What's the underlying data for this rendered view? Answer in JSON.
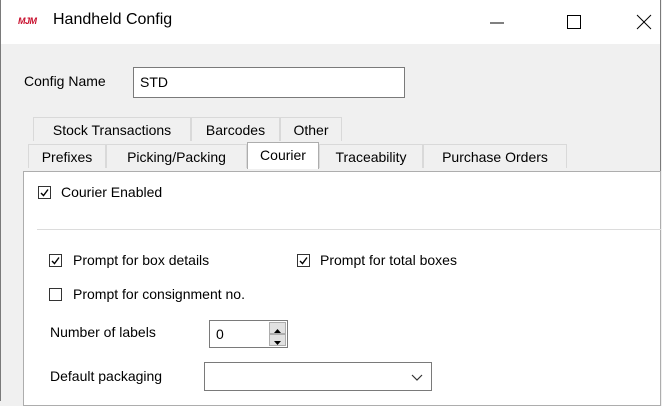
{
  "window": {
    "logo_text": "MJM",
    "title": "Handheld Config",
    "minimize_icon": "minimize-icon",
    "maximize_icon": "maximize-icon",
    "close_icon": "close-icon"
  },
  "form": {
    "config_name_label": "Config Name",
    "config_name_value": "STD"
  },
  "tabs": {
    "row1": [
      "Stock Transactions",
      "Barcodes",
      "Other"
    ],
    "row2": [
      "Prefixes",
      "Picking/Packing",
      "Courier",
      "Traceability",
      "Purchase Orders"
    ],
    "active": "Courier"
  },
  "courier": {
    "enabled_label": "Courier Enabled",
    "enabled_checked": true,
    "prompt_box_details_label": "Prompt for box details",
    "prompt_box_details_checked": true,
    "prompt_total_boxes_label": "Prompt for total boxes",
    "prompt_total_boxes_checked": true,
    "prompt_consignment_label": "Prompt for consignment no.",
    "prompt_consignment_checked": false,
    "number_of_labels_label": "Number of labels",
    "number_of_labels_value": "0",
    "default_packaging_label": "Default packaging",
    "default_packaging_value": ""
  }
}
